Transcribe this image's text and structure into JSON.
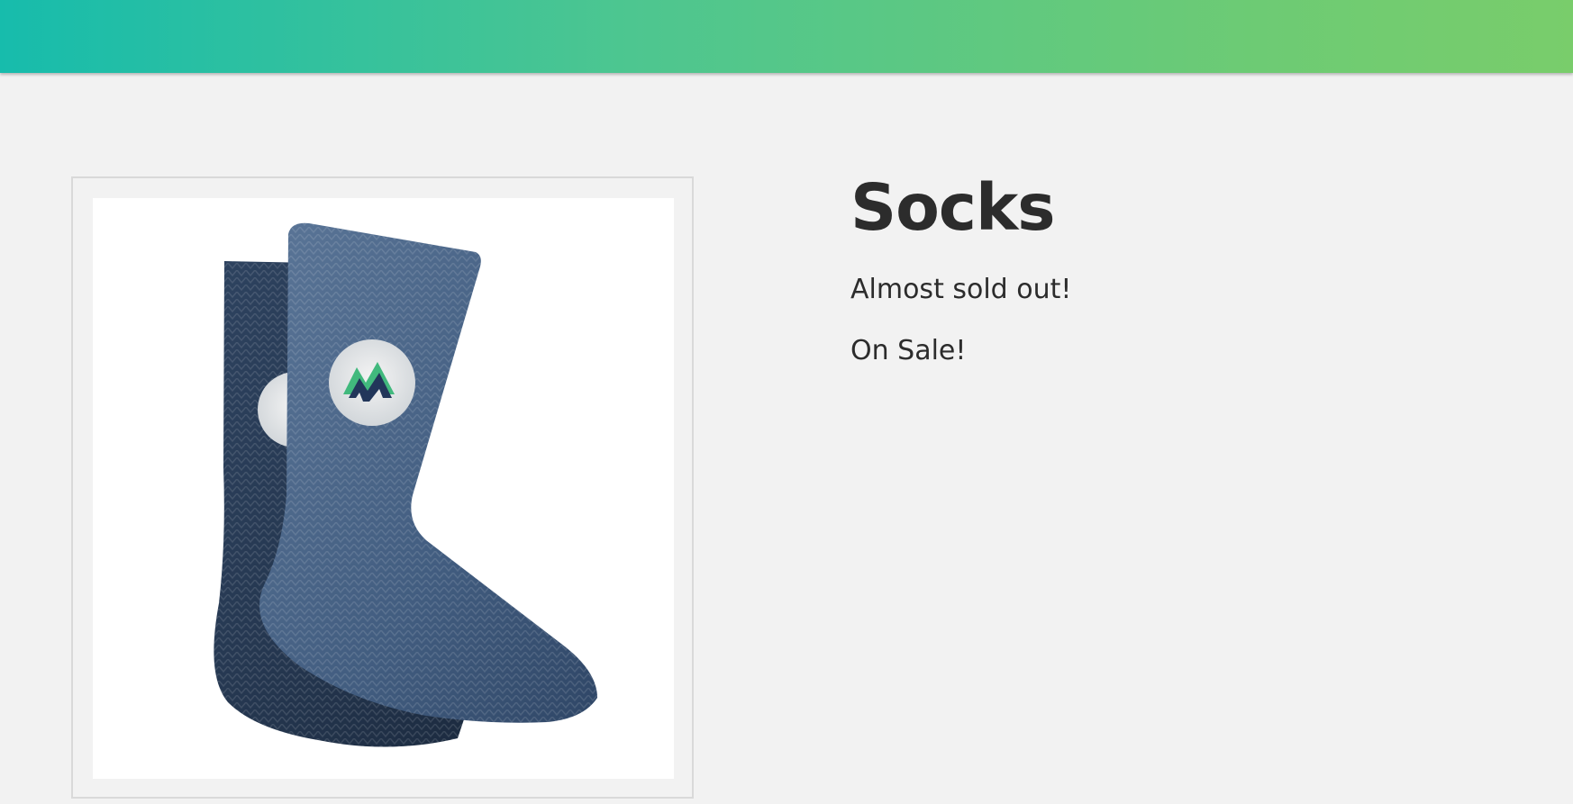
{
  "header": {
    "gradient_start": "#17bcac",
    "gradient_end": "#79cd6b"
  },
  "product": {
    "title": "Socks",
    "image_description_icon": "socks-image",
    "stock_status": "Almost sold out!",
    "sale_status": "On Sale!"
  },
  "colors": {
    "background": "#f2f2f2",
    "text": "#2c2c2c",
    "sock": "#3f5878",
    "logo_green": "#41b97d",
    "logo_navy": "#22365a"
  }
}
